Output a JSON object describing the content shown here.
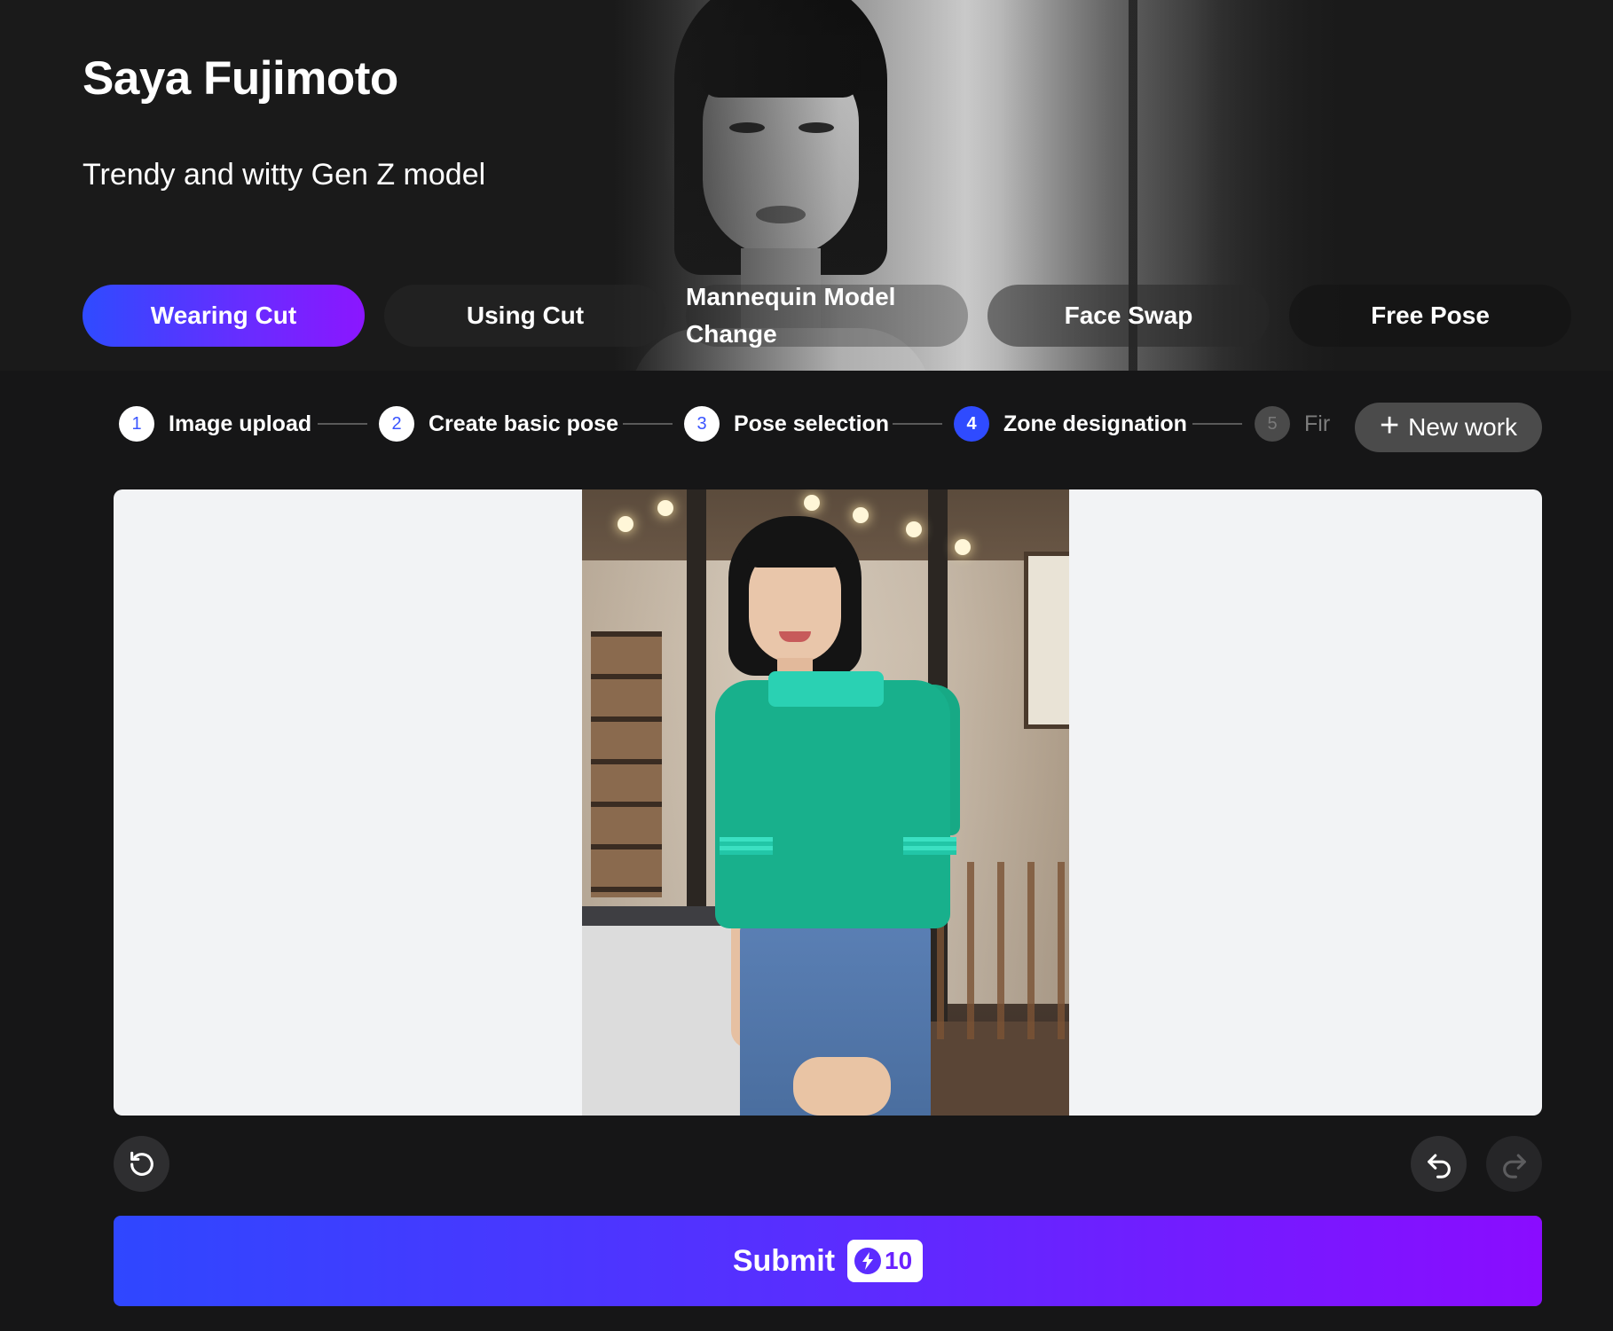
{
  "model": {
    "name": "Saya Fujimoto",
    "tagline": "Trendy and witty Gen Z model"
  },
  "tabs": [
    {
      "label": "Wearing Cut",
      "active": true
    },
    {
      "label": "Using Cut",
      "active": false
    },
    {
      "label": "Mannequin Model Change",
      "active": false
    },
    {
      "label": "Face Swap",
      "active": false
    },
    {
      "label": "Free Pose",
      "active": false
    }
  ],
  "stepper": {
    "steps": [
      {
        "num": "1",
        "label": "Image upload",
        "state": "done"
      },
      {
        "num": "2",
        "label": "Create basic pose",
        "state": "done"
      },
      {
        "num": "3",
        "label": "Pose selection",
        "state": "done"
      },
      {
        "num": "4",
        "label": "Zone designation",
        "state": "current"
      },
      {
        "num": "5",
        "label": "Fir",
        "state": "disabled"
      }
    ],
    "new_work_label": "New work"
  },
  "canvas": {
    "image_icon": "model-photo-with-masked-shirt"
  },
  "controls": {
    "reset_icon": "rotate-ccw-icon",
    "undo_icon": "undo-icon",
    "redo_icon": "redo-icon"
  },
  "submit": {
    "label": "Submit",
    "credits": "10",
    "credit_icon": "lightning-bolt-icon"
  },
  "colors": {
    "accent_start": "#2f47ff",
    "accent_end": "#8a0cff",
    "background": "#161617",
    "canvas_bg": "#f2f3f5"
  }
}
